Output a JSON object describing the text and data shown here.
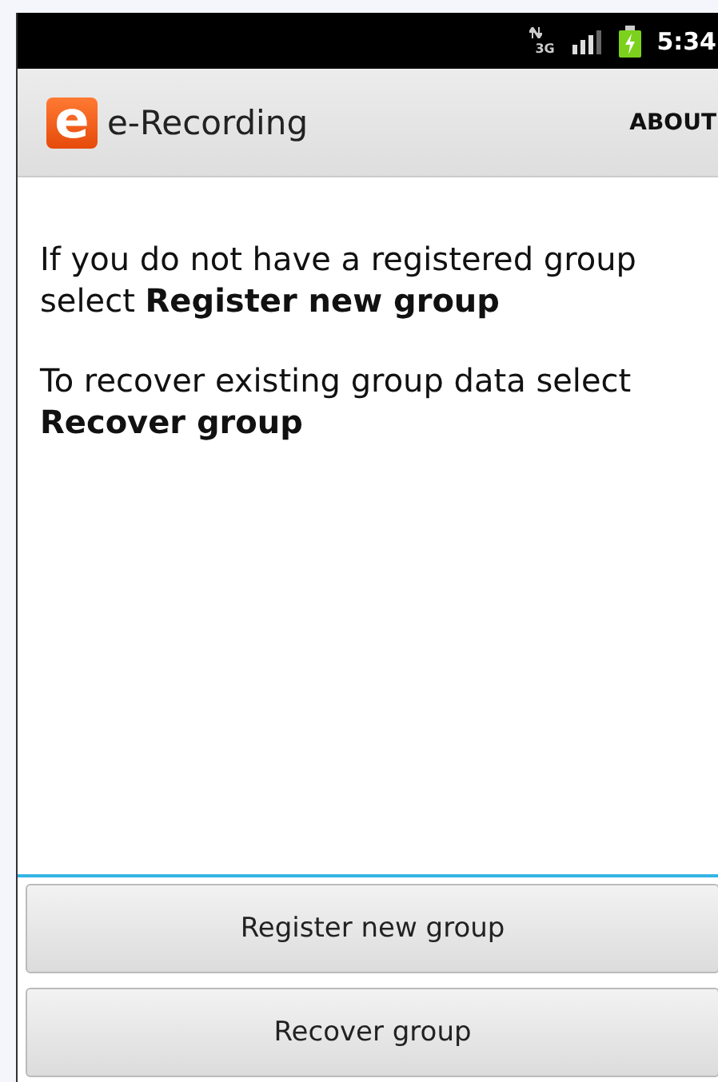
{
  "status_bar": {
    "network": "3G",
    "time": "5:34"
  },
  "action_bar": {
    "title": "e-Recording",
    "logo_letter": "e",
    "action": "ABOUT"
  },
  "paragraphs": [
    "If you do not have a registered group select **Register new group**",
    "To recover existing group data select **Recover group**"
  ],
  "buttons": [
    "Register new group",
    "Recover group"
  ]
}
